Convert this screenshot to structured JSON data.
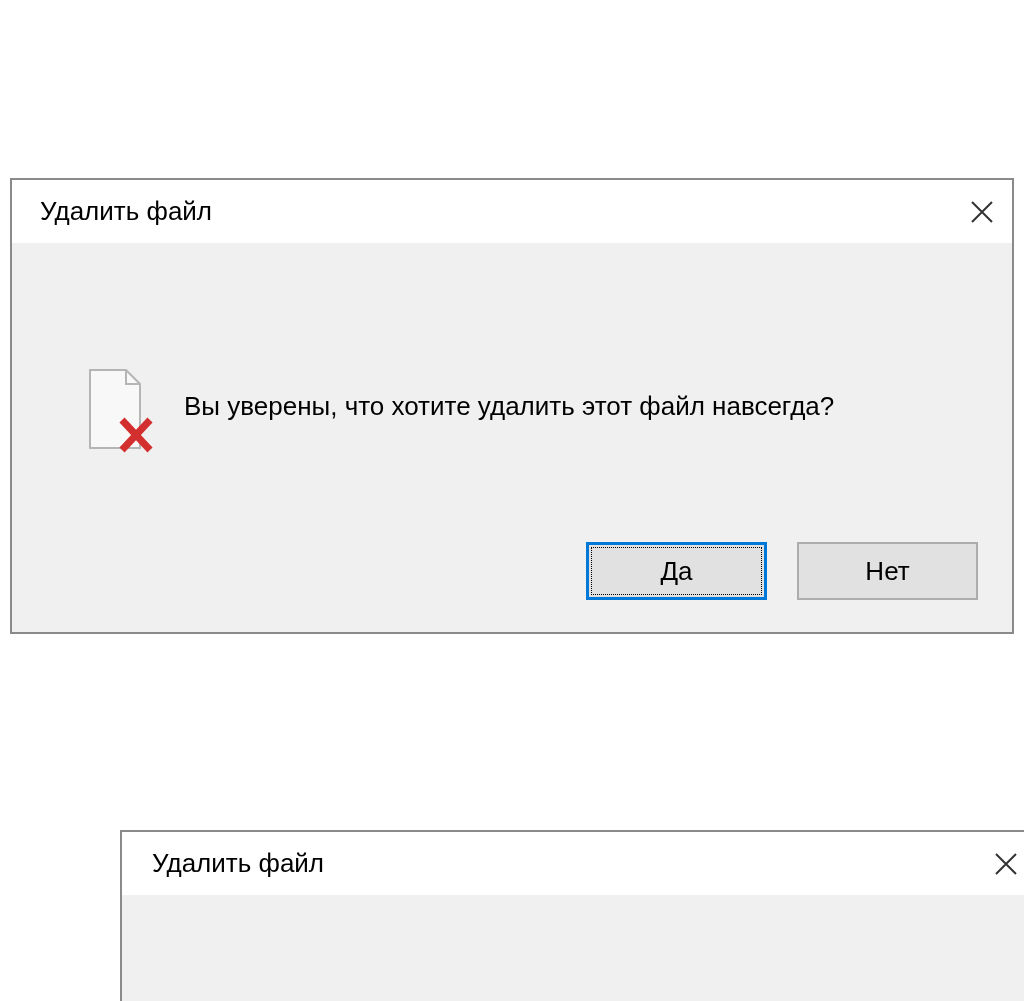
{
  "dialogs": [
    {
      "title": "Удалить файл",
      "message": "Вы уверены, что хотите удалить этот файл навсегда?",
      "buttons": [
        {
          "label": "Да",
          "focused": true
        },
        {
          "label": "Нет",
          "focused": false
        }
      ]
    },
    {
      "title": "Удалить файл"
    }
  ]
}
